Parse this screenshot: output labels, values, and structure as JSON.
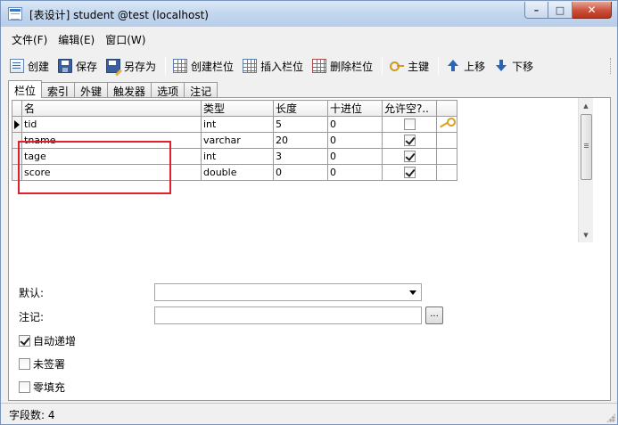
{
  "window": {
    "title": "[表设计] student @test (localhost)",
    "buttons": {
      "minimize": "–",
      "maximize": "□",
      "close": "✕"
    }
  },
  "menu": [
    "文件(F)",
    "编辑(E)",
    "窗口(W)"
  ],
  "toolbar": {
    "create": "创建",
    "save": "保存",
    "save_as": "另存为",
    "create_field": "创建栏位",
    "insert_field": "插入栏位",
    "delete_field": "删除栏位",
    "primary_key": "主键",
    "move_up": "上移",
    "move_down": "下移"
  },
  "tabs": [
    "栏位",
    "索引",
    "外键",
    "触发器",
    "选项",
    "注记"
  ],
  "grid": {
    "columns": [
      "名",
      "类型",
      "长度",
      "十进位",
      "允许空?..",
      ""
    ],
    "rows": [
      {
        "name": "tid",
        "type": "int",
        "length": "5",
        "decimals": "0",
        "allow_null": false,
        "primary_key": true,
        "current": true
      },
      {
        "name": "tname",
        "type": "varchar",
        "length": "20",
        "decimals": "0",
        "allow_null": true,
        "primary_key": false,
        "current": false
      },
      {
        "name": "tage",
        "type": "int",
        "length": "3",
        "decimals": "0",
        "allow_null": true,
        "primary_key": false,
        "current": false
      },
      {
        "name": "score",
        "type": "double",
        "length": "0",
        "decimals": "0",
        "allow_null": true,
        "primary_key": false,
        "current": false
      }
    ]
  },
  "properties": {
    "default_label": "默认:",
    "default_value": "",
    "comment_label": "注记:",
    "comment_value": "",
    "comment_button": "...",
    "auto_increment": {
      "label": "自动递增",
      "checked": true
    },
    "unsigned": {
      "label": "未签署",
      "checked": false
    },
    "zerofill": {
      "label": "零填充",
      "checked": false
    }
  },
  "status": "字段数: 4",
  "colors": {
    "highlight_box": "#e0202a",
    "titlebar": "#c3d6ee",
    "key": "#d6a21e"
  }
}
